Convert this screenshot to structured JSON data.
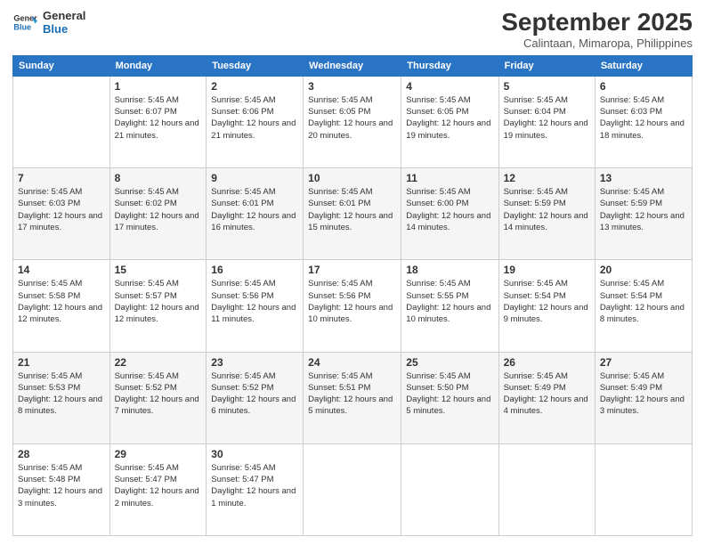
{
  "header": {
    "logo_line1": "General",
    "logo_line2": "Blue",
    "month": "September 2025",
    "location": "Calintaan, Mimaropa, Philippines"
  },
  "weekdays": [
    "Sunday",
    "Monday",
    "Tuesday",
    "Wednesday",
    "Thursday",
    "Friday",
    "Saturday"
  ],
  "weeks": [
    [
      {
        "day": "",
        "info": ""
      },
      {
        "day": "1",
        "info": "Sunrise: 5:45 AM\nSunset: 6:07 PM\nDaylight: 12 hours\nand 21 minutes."
      },
      {
        "day": "2",
        "info": "Sunrise: 5:45 AM\nSunset: 6:06 PM\nDaylight: 12 hours\nand 21 minutes."
      },
      {
        "day": "3",
        "info": "Sunrise: 5:45 AM\nSunset: 6:05 PM\nDaylight: 12 hours\nand 20 minutes."
      },
      {
        "day": "4",
        "info": "Sunrise: 5:45 AM\nSunset: 6:05 PM\nDaylight: 12 hours\nand 19 minutes."
      },
      {
        "day": "5",
        "info": "Sunrise: 5:45 AM\nSunset: 6:04 PM\nDaylight: 12 hours\nand 19 minutes."
      },
      {
        "day": "6",
        "info": "Sunrise: 5:45 AM\nSunset: 6:03 PM\nDaylight: 12 hours\nand 18 minutes."
      }
    ],
    [
      {
        "day": "7",
        "info": "Sunrise: 5:45 AM\nSunset: 6:03 PM\nDaylight: 12 hours\nand 17 minutes."
      },
      {
        "day": "8",
        "info": "Sunrise: 5:45 AM\nSunset: 6:02 PM\nDaylight: 12 hours\nand 17 minutes."
      },
      {
        "day": "9",
        "info": "Sunrise: 5:45 AM\nSunset: 6:01 PM\nDaylight: 12 hours\nand 16 minutes."
      },
      {
        "day": "10",
        "info": "Sunrise: 5:45 AM\nSunset: 6:01 PM\nDaylight: 12 hours\nand 15 minutes."
      },
      {
        "day": "11",
        "info": "Sunrise: 5:45 AM\nSunset: 6:00 PM\nDaylight: 12 hours\nand 14 minutes."
      },
      {
        "day": "12",
        "info": "Sunrise: 5:45 AM\nSunset: 5:59 PM\nDaylight: 12 hours\nand 14 minutes."
      },
      {
        "day": "13",
        "info": "Sunrise: 5:45 AM\nSunset: 5:59 PM\nDaylight: 12 hours\nand 13 minutes."
      }
    ],
    [
      {
        "day": "14",
        "info": "Sunrise: 5:45 AM\nSunset: 5:58 PM\nDaylight: 12 hours\nand 12 minutes."
      },
      {
        "day": "15",
        "info": "Sunrise: 5:45 AM\nSunset: 5:57 PM\nDaylight: 12 hours\nand 12 minutes."
      },
      {
        "day": "16",
        "info": "Sunrise: 5:45 AM\nSunset: 5:56 PM\nDaylight: 12 hours\nand 11 minutes."
      },
      {
        "day": "17",
        "info": "Sunrise: 5:45 AM\nSunset: 5:56 PM\nDaylight: 12 hours\nand 10 minutes."
      },
      {
        "day": "18",
        "info": "Sunrise: 5:45 AM\nSunset: 5:55 PM\nDaylight: 12 hours\nand 10 minutes."
      },
      {
        "day": "19",
        "info": "Sunrise: 5:45 AM\nSunset: 5:54 PM\nDaylight: 12 hours\nand 9 minutes."
      },
      {
        "day": "20",
        "info": "Sunrise: 5:45 AM\nSunset: 5:54 PM\nDaylight: 12 hours\nand 8 minutes."
      }
    ],
    [
      {
        "day": "21",
        "info": "Sunrise: 5:45 AM\nSunset: 5:53 PM\nDaylight: 12 hours\nand 8 minutes."
      },
      {
        "day": "22",
        "info": "Sunrise: 5:45 AM\nSunset: 5:52 PM\nDaylight: 12 hours\nand 7 minutes."
      },
      {
        "day": "23",
        "info": "Sunrise: 5:45 AM\nSunset: 5:52 PM\nDaylight: 12 hours\nand 6 minutes."
      },
      {
        "day": "24",
        "info": "Sunrise: 5:45 AM\nSunset: 5:51 PM\nDaylight: 12 hours\nand 5 minutes."
      },
      {
        "day": "25",
        "info": "Sunrise: 5:45 AM\nSunset: 5:50 PM\nDaylight: 12 hours\nand 5 minutes."
      },
      {
        "day": "26",
        "info": "Sunrise: 5:45 AM\nSunset: 5:49 PM\nDaylight: 12 hours\nand 4 minutes."
      },
      {
        "day": "27",
        "info": "Sunrise: 5:45 AM\nSunset: 5:49 PM\nDaylight: 12 hours\nand 3 minutes."
      }
    ],
    [
      {
        "day": "28",
        "info": "Sunrise: 5:45 AM\nSunset: 5:48 PM\nDaylight: 12 hours\nand 3 minutes."
      },
      {
        "day": "29",
        "info": "Sunrise: 5:45 AM\nSunset: 5:47 PM\nDaylight: 12 hours\nand 2 minutes."
      },
      {
        "day": "30",
        "info": "Sunrise: 5:45 AM\nSunset: 5:47 PM\nDaylight: 12 hours\nand 1 minute."
      },
      {
        "day": "",
        "info": ""
      },
      {
        "day": "",
        "info": ""
      },
      {
        "day": "",
        "info": ""
      },
      {
        "day": "",
        "info": ""
      }
    ]
  ]
}
